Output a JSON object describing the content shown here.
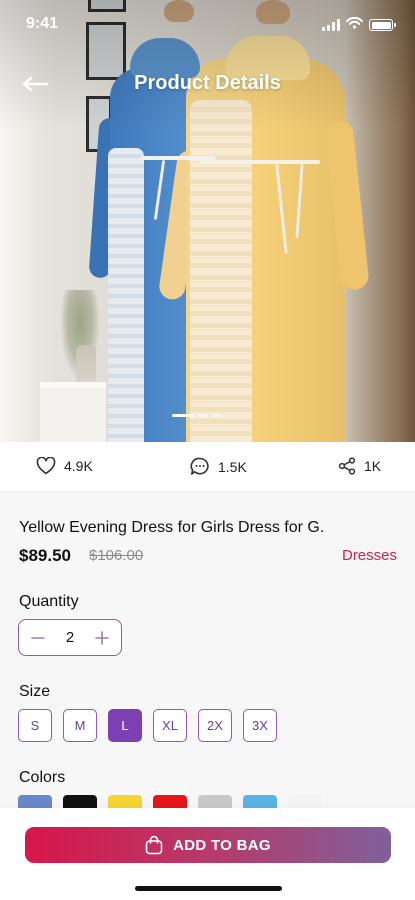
{
  "status_bar": {
    "time": "9:41"
  },
  "nav": {
    "title": "Product Details"
  },
  "pager": {
    "count": 3,
    "active": 0
  },
  "stats": {
    "likes": "4.9K",
    "comments": "1.5K",
    "shares": "1K"
  },
  "product": {
    "name": "Yellow Evening Dress for Girls Dress for G.",
    "price": "$89.50",
    "old_price": "$106.00",
    "category": "Dresses"
  },
  "quantity": {
    "label": "Quantity",
    "value": "2"
  },
  "size": {
    "label": "Size",
    "options": [
      "S",
      "M",
      "L",
      "XL",
      "2X",
      "3X"
    ],
    "selected": "L"
  },
  "colors": {
    "label": "Colors",
    "swatches": [
      "#6a87c9",
      "#111111",
      "#f5d430",
      "#e5141a",
      "#c9c9c9",
      "#59b3e6",
      "#f4f4f4"
    ]
  },
  "cta": {
    "label": "ADD TO BAG"
  },
  "theme": {
    "accent": "#7d3fb2",
    "category_color": "#d4204e"
  }
}
